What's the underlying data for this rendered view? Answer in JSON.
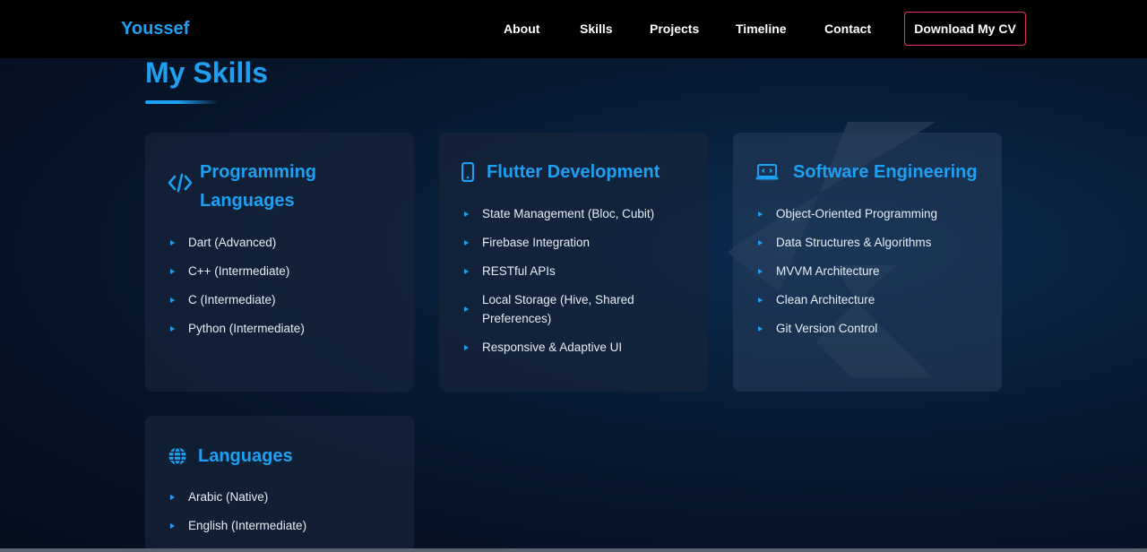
{
  "brand": "Youssef",
  "nav": {
    "links": [
      "About",
      "Skills",
      "Projects",
      "Timeline",
      "Contact"
    ],
    "cv_button": "Download My CV"
  },
  "section": {
    "title": "My Skills"
  },
  "cards": [
    {
      "icon": "code-icon",
      "title_line1": "Programming",
      "title_line2": "Languages",
      "items": [
        "Dart (Advanced)",
        "C++ (Intermediate)",
        "C (Intermediate)",
        "Python (Intermediate)"
      ]
    },
    {
      "icon": "mobile-icon",
      "title": "Flutter Development",
      "items": [
        "State Management (Bloc, Cubit)",
        "Firebase Integration",
        "RESTful APIs",
        "Local Storage (Hive, Shared Preferences)",
        "Responsive & Adaptive UI"
      ]
    },
    {
      "icon": "laptop-code-icon",
      "title": "Software Engineering",
      "items": [
        "Object-Oriented Programming",
        "Data Structures & Algorithms",
        "MVVM Architecture",
        "Clean Architecture",
        "Git Version Control"
      ]
    },
    {
      "icon": "globe-icon",
      "title": "Languages",
      "items": [
        "Arabic (Native)",
        "English (Intermediate)"
      ]
    }
  ],
  "colors": {
    "accent": "#1ea0f2",
    "cv_border": "#e8305f",
    "navbar_bg": "#000000"
  }
}
